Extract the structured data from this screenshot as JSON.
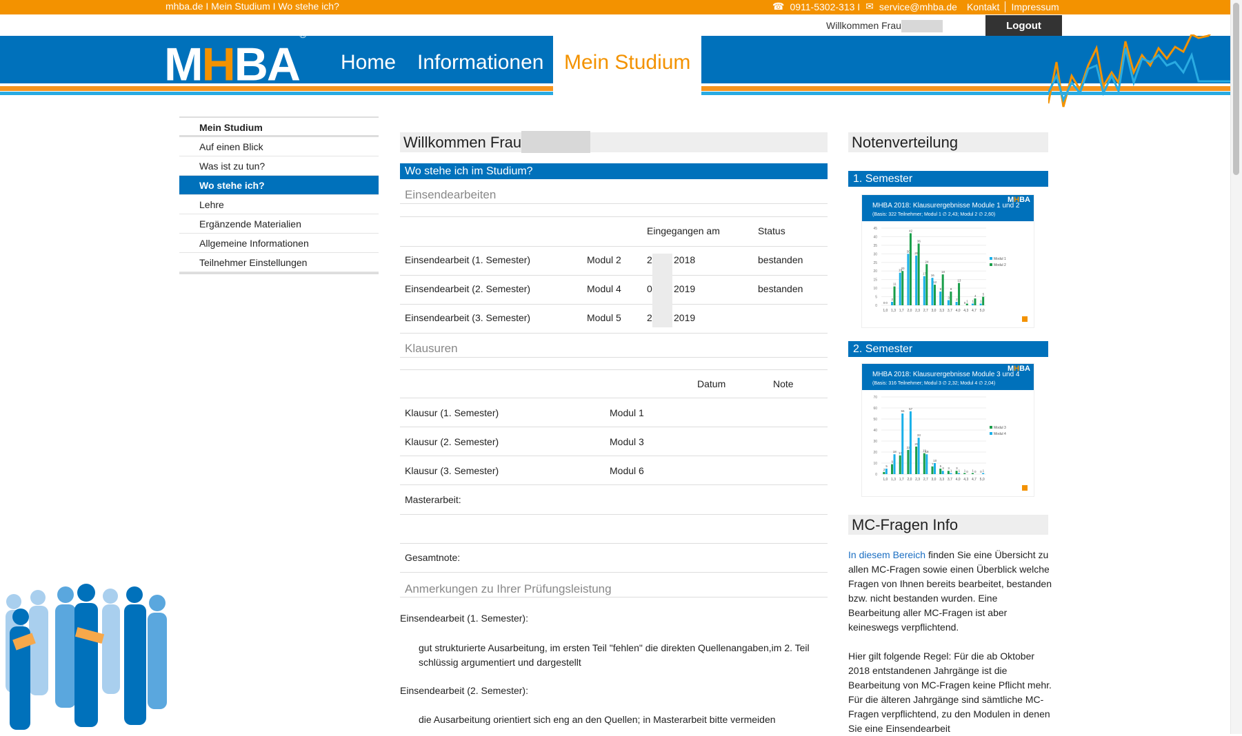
{
  "topbar": {
    "breadcrumb": "mhba.de I Mein Studium I Wo stehe ich?",
    "phone": "0911-5302-313 I",
    "email": "service@mhba.de",
    "kontakt": "Kontakt",
    "impressum": "Impressum"
  },
  "header": {
    "welcome": "Willkommen Frau",
    "logout": "Logout",
    "logo": {
      "m": "M",
      "h": "H",
      "ba": "BA",
      "reg": "®"
    },
    "nav": [
      "Home",
      "Informationen",
      "Mein Studium"
    ]
  },
  "sidebar": {
    "title": "Mein Studium",
    "items": [
      "Auf einen Blick",
      "Was ist zu tun?",
      "Wo stehe ich?",
      "Lehre",
      "Ergänzende Materialien",
      "Allgemeine Informationen",
      "Teilnehmer Einstellungen"
    ]
  },
  "main": {
    "title": "Willkommen Frau",
    "section": "Wo stehe ich im Studium?",
    "einsende": {
      "title": "Einsendearbeiten",
      "headers": [
        "Eingegangen am",
        "Status"
      ],
      "rows": [
        [
          "Einsendearbeit (1. Semester)",
          "Modul 2",
          "2",
          "2018",
          "bestanden"
        ],
        [
          "Einsendearbeit (2. Semester)",
          "Modul 4",
          "0",
          "2019",
          "bestanden"
        ],
        [
          "Einsendearbeit (3. Semester)",
          "Modul 5",
          "2",
          "2019",
          ""
        ]
      ]
    },
    "klausuren": {
      "title": "Klausuren",
      "headers": [
        "Datum",
        "Note"
      ],
      "rows": [
        [
          "Klausur (1. Semester)",
          "Modul 1"
        ],
        [
          "Klausur (2. Semester)",
          "Modul 3"
        ],
        [
          "Klausur (3. Semester)",
          "Modul 6"
        ]
      ]
    },
    "masterarbeit": "Masterarbeit:",
    "gesamtnote": "Gesamtnote:",
    "anmerkungen": {
      "title": "Anmerkungen zu Ihrer Prüfungsleistung",
      "items": [
        {
          "label": "Einsendearbeit (1. Semester):",
          "text": "gut strukturierte Ausarbeitung, im ersten Teil \"fehlen\" die direkten Quellenangaben,im 2. Teil schlüssig argumentiert und dargestellt"
        },
        {
          "label": "Einsendearbeit (2. Semester):",
          "text": "die Ausarbeitung orientiert sich eng an den Quellen; in Masterarbeit bitte vermeiden"
        }
      ]
    }
  },
  "right": {
    "title": "Notenverteilung",
    "sem1": "1. Semester",
    "sem2": "2. Semester",
    "mc_title": "MC-Fragen Info",
    "mc_link": "In diesem Bereich",
    "mc_text1": " finden Sie eine Übersicht zu allen MC-Fragen sowie einen Überblick welche Fragen von Ihnen bereits bearbeitet, bestanden bzw. nicht bestanden wurden. Eine Bearbeitung aller MC-Fragen ist aber keineswegs verpflichtend.",
    "mc_text2": "Hier gilt folgende Regel: Für die ab Oktober 2018 entstandenen Jahrgänge ist die Bearbeitung von MC-Fragen keine Pflicht mehr. Für die älteren Jahrgänge sind sämtliche MC-Fragen verpflichtend, zu den Modulen in denen Sie eine Einsendearbeit"
  },
  "colors": {
    "blue": "#0071bb",
    "orange": "#f39200",
    "bar_blue": "#1ab0e8",
    "bar_green": "#1a9e4a"
  },
  "chart_data": [
    {
      "type": "bar",
      "logo": "MHBA",
      "title": "MHBA 2018: Klausurergebnisse Module 1 und 2",
      "subtitle": "(Basis: 322 Teilnehmer; Modul 1 ∅ 2,43; Modul 2 ∅ 2,60)",
      "categories": [
        "1,0",
        "1,3",
        "1,7",
        "2,0",
        "2,3",
        "2,7",
        "3,0",
        "3,3",
        "3,7",
        "4,0",
        "4,3",
        "4,7",
        "5,0"
      ],
      "ylim": [
        0,
        45
      ],
      "ystep": 5,
      "legend": "right",
      "series": [
        {
          "name": "Modul 1",
          "color": "#1ab0e8",
          "values": [
            0,
            2,
            19,
            30,
            29,
            17,
            16,
            8,
            3,
            2,
            0,
            1,
            1
          ]
        },
        {
          "name": "Modul 2",
          "color": "#1a9e4a",
          "values": [
            0,
            11,
            20,
            42,
            36,
            24,
            12,
            18,
            8,
            13,
            1,
            4,
            5
          ]
        }
      ]
    },
    {
      "type": "bar",
      "logo": "MHBA",
      "title": "MHBA 2018: Klausurergebnisse Module 3 und 4",
      "subtitle": "(Basis: 316 Teilnehmer; Modul 3 ∅ 2,32; Modul 4 ∅ 2,04)",
      "categories": [
        "1,0",
        "1,3",
        "1,7",
        "2,0",
        "2,3",
        "2,7",
        "3,0",
        "3,3",
        "3,7",
        "4,0",
        "4,3",
        "4,7",
        "5,0"
      ],
      "ylim": [
        0,
        70
      ],
      "ystep": 10,
      "legend": "right",
      "series": [
        {
          "name": "Modul 3",
          "color": "#1a9e4a",
          "values": [
            2,
            9,
            17,
            22,
            25,
            19,
            7,
            5,
            3,
            3,
            1,
            1,
            0
          ]
        },
        {
          "name": "Modul 4",
          "color": "#1ab0e8",
          "values": [
            5,
            18,
            55,
            57,
            33,
            18,
            10,
            3,
            1,
            1,
            0,
            0,
            1
          ]
        }
      ]
    }
  ]
}
